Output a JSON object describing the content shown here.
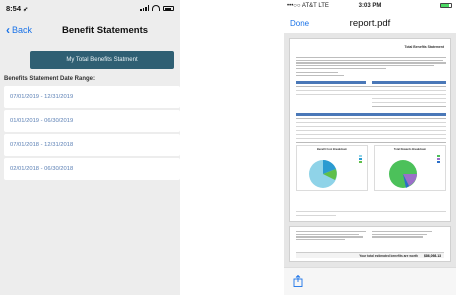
{
  "left_phone": {
    "status": {
      "time": "8:54",
      "location_glyph": "➶"
    },
    "nav": {
      "back_label": "Back",
      "title": "Benefit Statements"
    },
    "total_button": "My Total Benefits Statment",
    "range_label": "Benefits Statement Date Range:",
    "ranges": [
      "07/01/2019 - 12/31/2019",
      "01/01/2019 - 06/30/2019",
      "07/01/2018 - 12/31/2018",
      "02/01/2018 - 06/30/2018"
    ],
    "colors": {
      "accent": "#1a73e8",
      "button_bg": "#2f5f73",
      "range_text": "#5a7fb4"
    }
  },
  "right_phone": {
    "status": {
      "carrier": "•••○○ AT&T  LTE",
      "time": "3:03 PM"
    },
    "nav": {
      "done_label": "Done",
      "title": "report.pdf"
    },
    "pdf": {
      "heading": "Total Benefits Statement",
      "chart1_title": "Benefit Cost Breakdown",
      "chart2_title": "Total Rewards Breakdown",
      "total_label": "Your total estimated benefits are worth",
      "total_value": "$86,098.13"
    },
    "toolbar_icon": "share-icon"
  }
}
